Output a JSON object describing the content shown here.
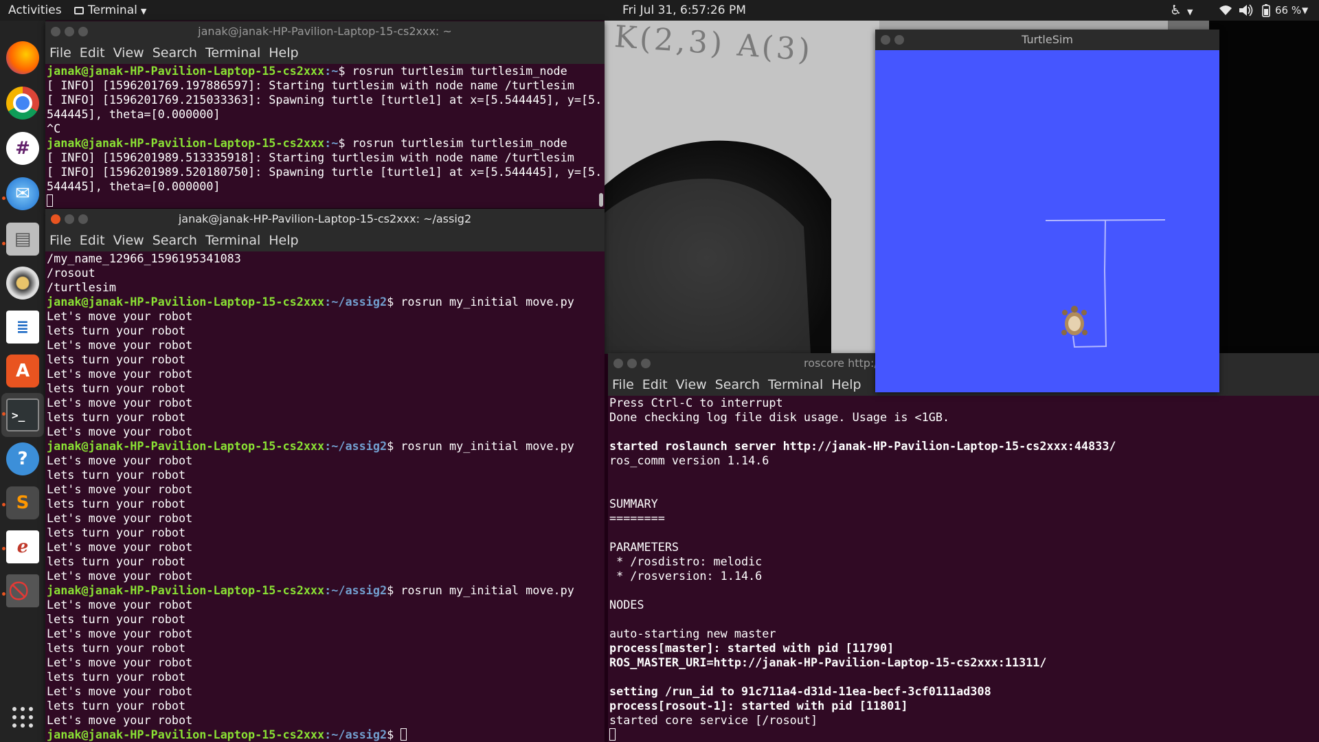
{
  "topbar": {
    "activities": "Activities",
    "app_name": "Terminal",
    "clock": "Fri Jul 31, 6:57:26 PM",
    "battery": "66 %"
  },
  "dock": {
    "apps": [
      "firefox-icon",
      "chrome-icon",
      "slack-icon",
      "thunderbird-icon",
      "files-icon",
      "rhythmbox-icon",
      "writer-icon",
      "software-icon",
      "terminal-icon",
      "help-icon",
      "sublime-icon",
      "evince-icon",
      "blocked-icon"
    ],
    "show_apps_label": "Show Applications"
  },
  "menu": {
    "file": "File",
    "edit": "Edit",
    "view": "View",
    "search": "Search",
    "terminal": "Terminal",
    "help": "Help"
  },
  "terminal1": {
    "title": "janak@janak-HP-Pavilion-Laptop-15-cs2xxx: ~",
    "lines": [
      {
        "user": "janak@janak-HP-Pavilion-Laptop-15-cs2xxx",
        "path": ":~",
        "text": "$ rosrun turtlesim turtlesim_node"
      },
      {
        "text": "[ INFO] [1596201769.197886597]: Starting turtlesim with node name /turtlesim"
      },
      {
        "text": "[ INFO] [1596201769.215033363]: Spawning turtle [turtle1] at x=[5.544445], y=[5."
      },
      {
        "text": "544445], theta=[0.000000]"
      },
      {
        "text": "^C"
      },
      {
        "user": "janak@janak-HP-Pavilion-Laptop-15-cs2xxx",
        "path": ":~",
        "text": "$ rosrun turtlesim turtlesim_node"
      },
      {
        "text": "[ INFO] [1596201989.513335918]: Starting turtlesim with node name /turtlesim"
      },
      {
        "text": "[ INFO] [1596201989.520180750]: Spawning turtle [turtle1] at x=[5.544445], y=[5."
      },
      {
        "text": "544445], theta=[0.000000]"
      }
    ]
  },
  "terminal2": {
    "title": "janak@janak-HP-Pavilion-Laptop-15-cs2xxx: ~/assig2",
    "lines": [
      {
        "text": "/my_name_12966_1596195341083"
      },
      {
        "text": "/rosout"
      },
      {
        "text": "/turtlesim"
      },
      {
        "user": "janak@janak-HP-Pavilion-Laptop-15-cs2xxx",
        "path": ":~/assig2",
        "text": "$ rosrun my_initial move.py"
      },
      {
        "text": "Let's move your robot"
      },
      {
        "text": "lets turn your robot"
      },
      {
        "text": "Let's move your robot"
      },
      {
        "text": "lets turn your robot"
      },
      {
        "text": "Let's move your robot"
      },
      {
        "text": "lets turn your robot"
      },
      {
        "text": "Let's move your robot"
      },
      {
        "text": "lets turn your robot"
      },
      {
        "text": "Let's move your robot"
      },
      {
        "user": "janak@janak-HP-Pavilion-Laptop-15-cs2xxx",
        "path": ":~/assig2",
        "text": "$ rosrun my_initial move.py"
      },
      {
        "text": "Let's move your robot"
      },
      {
        "text": "lets turn your robot"
      },
      {
        "text": "Let's move your robot"
      },
      {
        "text": "lets turn your robot"
      },
      {
        "text": "Let's move your robot"
      },
      {
        "text": "lets turn your robot"
      },
      {
        "text": "Let's move your robot"
      },
      {
        "text": "lets turn your robot"
      },
      {
        "text": "Let's move your robot"
      },
      {
        "user": "janak@janak-HP-Pavilion-Laptop-15-cs2xxx",
        "path": ":~/assig2",
        "text": "$ rosrun my_initial move.py"
      },
      {
        "text": "Let's move your robot"
      },
      {
        "text": "lets turn your robot"
      },
      {
        "text": "Let's move your robot"
      },
      {
        "text": "lets turn your robot"
      },
      {
        "text": "Let's move your robot"
      },
      {
        "text": "lets turn your robot"
      },
      {
        "text": "Let's move your robot"
      },
      {
        "text": "lets turn your robot"
      },
      {
        "text": "Let's move your robot"
      }
    ],
    "prompt": {
      "user": "janak@janak-HP-Pavilion-Laptop-15-cs2xxx",
      "path": ":~/assig2",
      "text": "$ "
    }
  },
  "terminal3": {
    "title": "roscore http:/",
    "lines": [
      {
        "text": "Press Ctrl-C to interrupt"
      },
      {
        "text": "Done checking log file disk usage. Usage is <1GB."
      },
      {
        "text": ""
      },
      {
        "text": "started roslaunch server http://janak-HP-Pavilion-Laptop-15-cs2xxx:44833/",
        "bold": true
      },
      {
        "text": "ros_comm version 1.14.6"
      },
      {
        "text": ""
      },
      {
        "text": ""
      },
      {
        "text": "SUMMARY"
      },
      {
        "text": "========"
      },
      {
        "text": ""
      },
      {
        "text": "PARAMETERS"
      },
      {
        "text": " * /rosdistro: melodic"
      },
      {
        "text": " * /rosversion: 1.14.6"
      },
      {
        "text": ""
      },
      {
        "text": "NODES"
      },
      {
        "text": ""
      },
      {
        "text": "auto-starting new master"
      },
      {
        "text": "process[master]: started with pid [11790]",
        "bold": true
      },
      {
        "text": "ROS_MASTER_URI=http://janak-HP-Pavilion-Laptop-15-cs2xxx:11311/",
        "bold": true
      },
      {
        "text": ""
      },
      {
        "text": "setting /run_id to 91c711a4-d31d-11ea-becf-3cf0111ad308",
        "bold": true
      },
      {
        "text": "process[rosout-1]: started with pid [11801]",
        "bold": true
      },
      {
        "text": "started core service [/rosout]"
      }
    ]
  },
  "turtlesim": {
    "title": "TurtleSim",
    "background_color": "#4556ff",
    "pen_color": "#b3b8ff"
  },
  "webcam": {
    "paper_text": "K(2,3) A(3)"
  }
}
